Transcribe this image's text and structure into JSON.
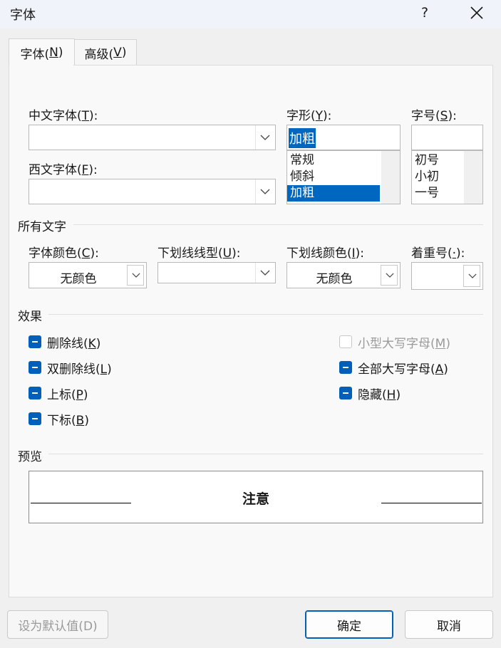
{
  "window": {
    "title": "字体",
    "help": "?"
  },
  "tabs": [
    {
      "label": "字体(",
      "accel": "N",
      "suffix": ")"
    },
    {
      "label": "高级(",
      "accel": "V",
      "suffix": ")"
    }
  ],
  "fonts": {
    "chinese_label": "中文字体(",
    "chinese_accel": "T",
    "chinese_suffix": "):",
    "chinese_value": "",
    "western_label": "西文字体(",
    "western_accel": "F",
    "western_suffix": "):",
    "western_value": ""
  },
  "style": {
    "label": "字形(",
    "accel": "Y",
    "suffix": "):",
    "value": "加粗",
    "options": [
      "常规",
      "倾斜",
      "加粗"
    ],
    "selected_index": 2
  },
  "size": {
    "label": "字号(",
    "accel": "S",
    "suffix": "):",
    "value": "",
    "options": [
      "初号",
      "小初",
      "一号"
    ]
  },
  "all_text": {
    "heading": "所有文字",
    "color_label": "字体颜色(",
    "color_accel": "C",
    "color_suffix": "):",
    "color_value": "无颜色",
    "underline_label": "下划线线型(",
    "underline_accel": "U",
    "underline_suffix": "):",
    "underline_value": "",
    "underline_color_label": "下划线颜色(",
    "underline_color_accel": "I",
    "underline_color_suffix": "):",
    "underline_color_value": "无颜色",
    "emphasis_label": "着重号(",
    "emphasis_accel": "·",
    "emphasis_suffix": "):",
    "emphasis_value": ""
  },
  "effects": {
    "heading": "效果",
    "strikethrough": {
      "label": "删除线(",
      "accel": "K",
      "suffix": ")",
      "state": "indeterminate"
    },
    "double_strikethrough": {
      "label": "双删除线(",
      "accel": "L",
      "suffix": ")",
      "state": "indeterminate"
    },
    "superscript": {
      "label": "上标(",
      "accel": "P",
      "suffix": ")",
      "state": "indeterminate"
    },
    "subscript": {
      "label": "下标(",
      "accel": "B",
      "suffix": ")",
      "state": "indeterminate"
    },
    "small_caps": {
      "label": "小型大写字母(",
      "accel": "M",
      "suffix": ")",
      "state": "disabled"
    },
    "all_caps": {
      "label": "全部大写字母(",
      "accel": "A",
      "suffix": ")",
      "state": "indeterminate"
    },
    "hidden": {
      "label": "隐藏(",
      "accel": "H",
      "suffix": ")",
      "state": "indeterminate"
    }
  },
  "preview": {
    "heading": "预览",
    "sample": "注意"
  },
  "buttons": {
    "default": "设为默认值(D)",
    "ok": "确定",
    "cancel": "取消"
  },
  "colors": {
    "accent": "#0067c0",
    "checkbox": "#005fb8"
  }
}
